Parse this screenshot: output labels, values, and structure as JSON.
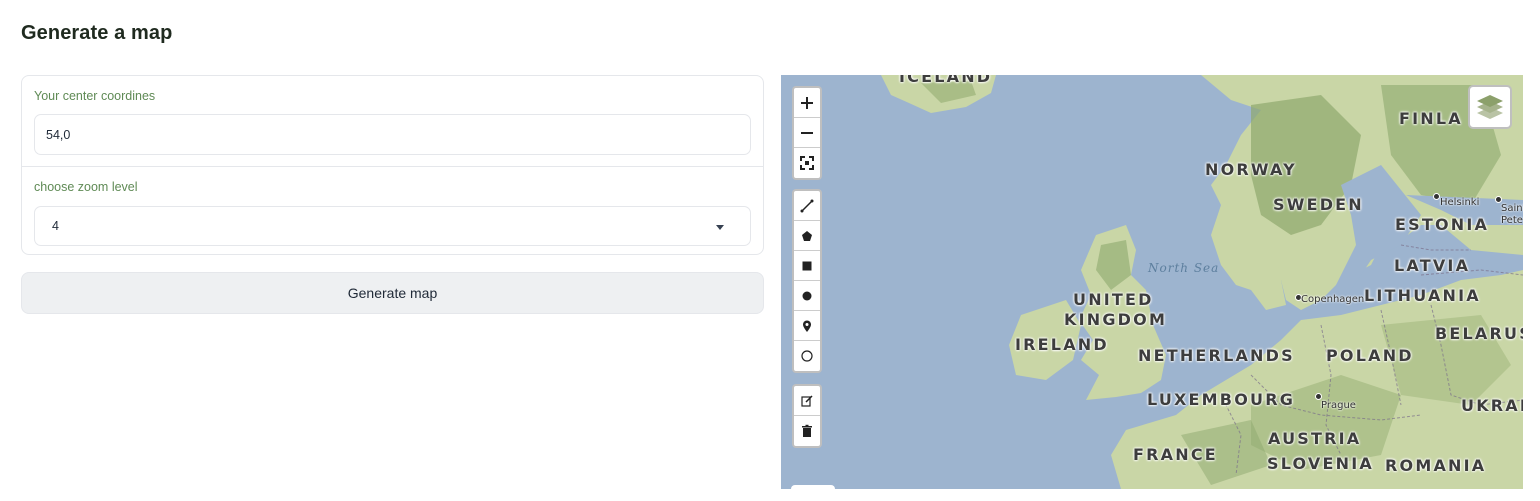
{
  "page": {
    "title": "Generate a map"
  },
  "form": {
    "coords_label": "Your center coordines",
    "coords_value": "54,0",
    "zoom_label": "choose zoom level",
    "zoom_value": "4"
  },
  "actions": {
    "generate_label": "Generate map"
  },
  "map": {
    "sea_label": "North Sea",
    "countries": {
      "iceland": "ICELAND",
      "norway": "NORWAY",
      "sweden": "SWEDEN",
      "finland": "FINLA",
      "estonia": "ESTONIA",
      "latvia": "LATVIA",
      "lithuania": "LITHUANIA",
      "belarus": "BELARUS",
      "uk_line1": "UNITED",
      "uk_line2": "KINGDOM",
      "ireland": "IRELAND",
      "netherlands": "NETHERLANDS",
      "poland": "POLAND",
      "luxembourg": "LUXEMBOURG",
      "ukraine": "UKRAI",
      "austria": "AUSTRIA",
      "france": "FRANCE",
      "slovenia": "SLOVENIA",
      "romania": "ROMANIA"
    },
    "cities": {
      "helsinki": "Helsinki",
      "saint": "Saint",
      "pete": "Pete",
      "copenhagen": "Copenhagen",
      "prague": "Prague"
    },
    "colors": {
      "water": "#9db4cf",
      "land": "#c9d6a6",
      "forest": "#8ea86e"
    },
    "controls": {
      "zoom": [
        "zoom-in-icon",
        "zoom-out-icon",
        "fullscreen-icon"
      ],
      "draw": [
        "polyline-icon",
        "polygon-icon",
        "rectangle-icon",
        "circle-marker-icon",
        "marker-icon",
        "circle-icon"
      ],
      "edit": [
        "edit-icon",
        "trash-icon"
      ],
      "layers": "layers-icon"
    }
  }
}
